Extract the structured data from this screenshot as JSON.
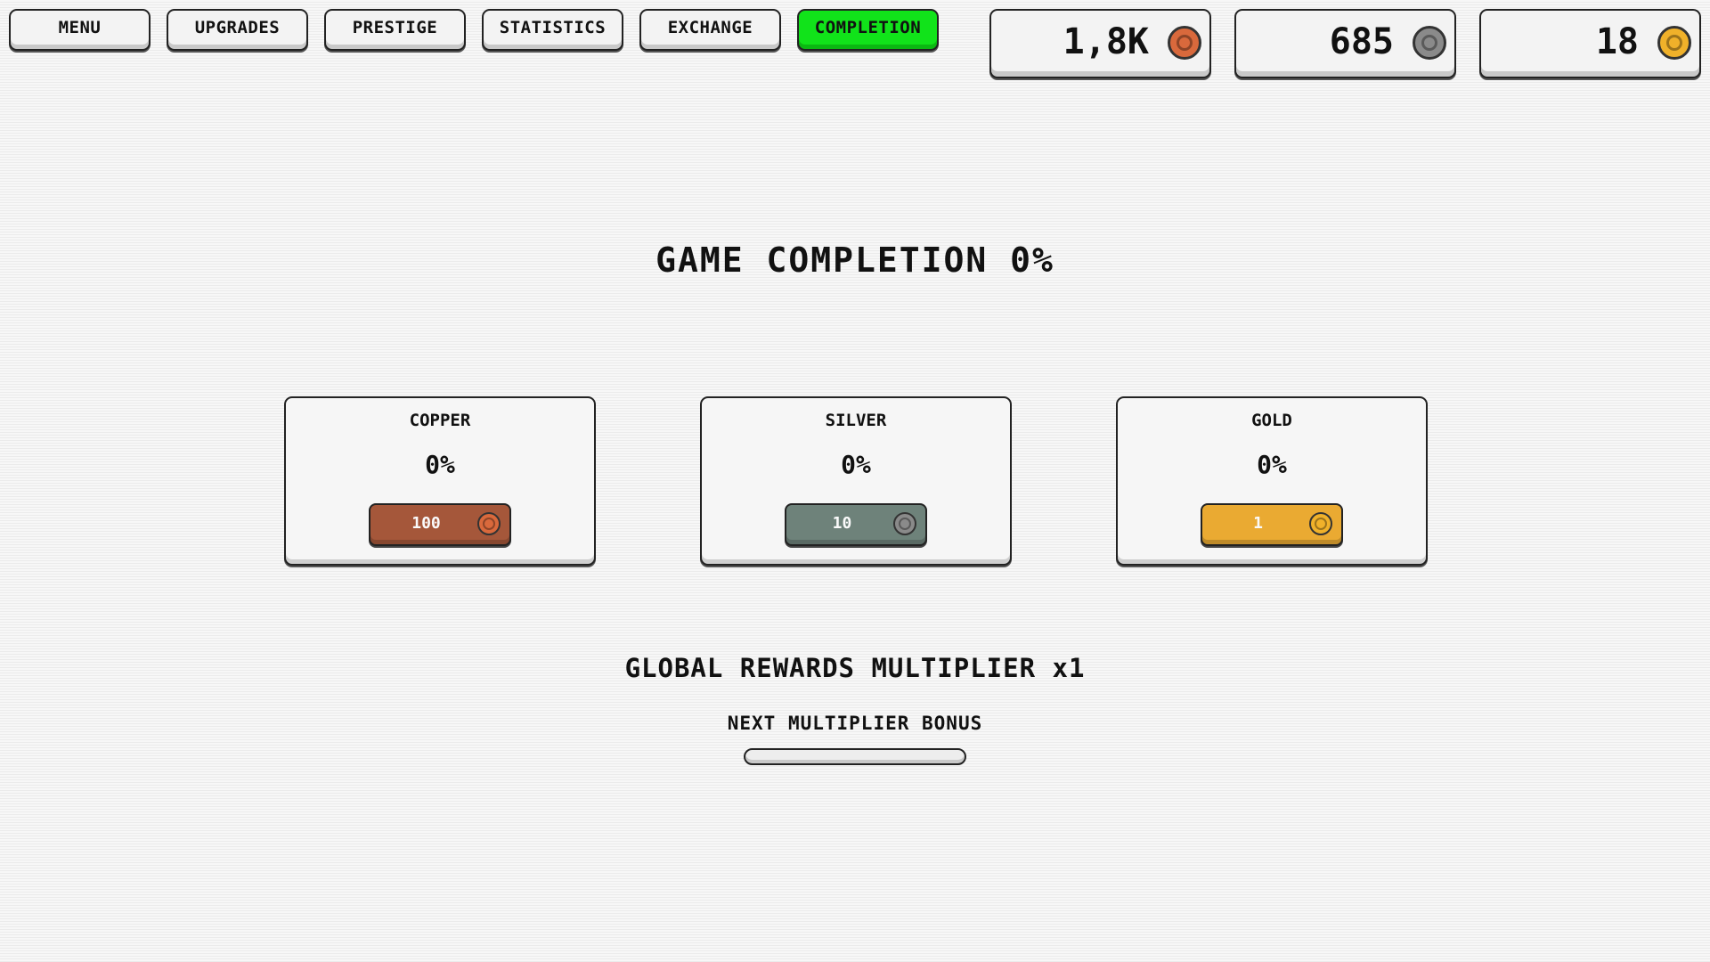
{
  "nav": {
    "menu": "MENU",
    "upgrades": "UPGRADES",
    "prestige": "PRESTIGE",
    "statistics": "STATISTICS",
    "exchange": "EXCHANGE",
    "completion": "COMPLETION"
  },
  "active_tab": "completion",
  "resources": {
    "copper": "1,8K",
    "silver": "685",
    "gold": "18"
  },
  "colors": {
    "copper": "#a5573a",
    "copper_coin": "#d9693c",
    "silver": "#6e827a",
    "silver_coin": "#8a8a8a",
    "gold": "#eaaa32",
    "gold_coin": "#f0b12a",
    "active_tab": "#11e31a"
  },
  "icons": {
    "copper": "copper-coin-icon",
    "silver": "silver-coin-icon",
    "gold": "gold-coin-icon"
  },
  "page_title": "GAME COMPLETION 0%",
  "cards": [
    {
      "name": "COPPER",
      "percent": "0%",
      "cost": "100"
    },
    {
      "name": "SILVER",
      "percent": "0%",
      "cost": "10"
    },
    {
      "name": "GOLD",
      "percent": "0%",
      "cost": "1"
    }
  ],
  "multiplier_text": "GLOBAL REWARDS MULTIPLIER x1",
  "next_bonus_label": "NEXT MULTIPLIER BONUS",
  "next_bonus_progress": 0
}
